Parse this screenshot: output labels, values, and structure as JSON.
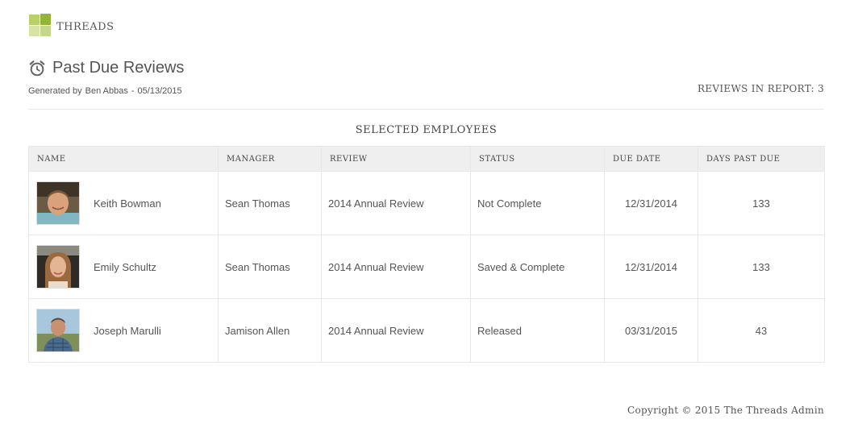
{
  "brand": {
    "name": "THREADS"
  },
  "report": {
    "title": "Past Due Reviews",
    "generated_prefix": "Generated by",
    "generated_by": "Ben Abbas",
    "separator": "-",
    "generated_date": "05/13/2015",
    "reviews_label": "REVIEWS IN REPORT: 3"
  },
  "section_title": "SELECTED EMPLOYEES",
  "table": {
    "columns": [
      "NAME",
      "MANAGER",
      "REVIEW",
      "STATUS",
      "DUE DATE",
      "DAYS PAST DUE"
    ],
    "rows": [
      {
        "name": "Keith Bowman",
        "manager": "Sean Thomas",
        "review": "2014 Annual Review",
        "status": "Not Complete",
        "due_date": "12/31/2014",
        "days_past_due": "133"
      },
      {
        "name": "Emily Schultz",
        "manager": "Sean Thomas",
        "review": "2014 Annual Review",
        "status": "Saved & Complete",
        "due_date": "12/31/2014",
        "days_past_due": "133"
      },
      {
        "name": "Joseph Marulli",
        "manager": "Jamison Allen",
        "review": "2014 Annual Review",
        "status": "Released",
        "due_date": "03/31/2015",
        "days_past_due": "43"
      }
    ]
  },
  "footer": {
    "copyright_label": "Copyright ©",
    "year": "2015",
    "owner": "The Threads Admin"
  },
  "colors": {
    "brand_green": "#94b43a",
    "brand_green_light": "#b9cf6b",
    "header_bg": "#efefef",
    "border": "#e8e8e8",
    "text": "#555555"
  },
  "icons": {
    "logo": "threads-logo-icon",
    "title": "alarm-clock-icon"
  }
}
